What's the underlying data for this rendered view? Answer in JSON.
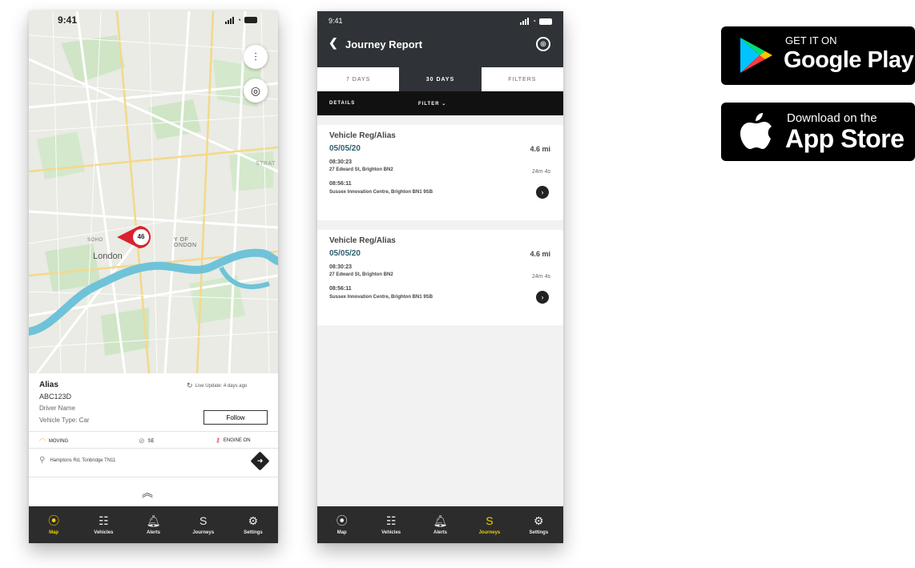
{
  "map_screen": {
    "status_time": "9:41",
    "map_labels": {
      "soho": "SOHO",
      "london": "London",
      "city": "Y OF\nONDON",
      "strat": "STRAT"
    },
    "marker_speed": "46",
    "vehicle": {
      "alias": "Alias",
      "reg": "ABC123D",
      "driver": "Driver Name",
      "vehicle_type": "Vehicle Type: Car",
      "live_update": "Live Update: 4 days ago",
      "follow_label": "Follow"
    },
    "stats": {
      "moving": "MOVING",
      "heading": "SE",
      "engine": "ENGINE ON"
    },
    "address": "Hamptons Rd, Tonbridge TN11",
    "tabs": [
      {
        "label": "Map",
        "icon": "map-pin-icon",
        "glyph": "⦿"
      },
      {
        "label": "Vehicles",
        "icon": "vehicles-icon",
        "glyph": "☷"
      },
      {
        "label": "Alerts",
        "icon": "bell-icon",
        "glyph": "🔔︎"
      },
      {
        "label": "Journeys",
        "icon": "journeys-icon",
        "glyph": "S"
      },
      {
        "label": "Settings",
        "icon": "gear-icon",
        "glyph": "⚙"
      }
    ]
  },
  "journey_screen": {
    "status_time": "9:41",
    "title": "Journey Report",
    "segments": [
      "7 DAYS",
      "30 DAYS",
      "FILTERS"
    ],
    "active_segment": "30 DAYS",
    "details_label": "DETAILS",
    "filter_label": "FILTER ⌄",
    "journeys": [
      {
        "vehicle": "Vehicle Reg/Alias",
        "date": "05/05/20",
        "distance": "4.6 mi",
        "start_time": "08:30:23",
        "start_address": "27 Edward St, Brighton BN2",
        "duration": "24m 4s",
        "end_time": "08:56:11",
        "end_address": "Sussex Innovation Centre, Brighton BN1 9SB"
      },
      {
        "vehicle": "Vehicle Reg/Alias",
        "date": "05/05/20",
        "distance": "4.6 mi",
        "start_time": "08:30:23",
        "start_address": "27 Edward St, Brighton BN2",
        "duration": "24m 4s",
        "end_time": "08:56:11",
        "end_address": "Sussex Innovation Centre, Brighton BN1 9SB"
      }
    ],
    "tabs": [
      {
        "label": "Map",
        "icon": "map-pin-icon",
        "glyph": "⦿"
      },
      {
        "label": "Vehicles",
        "icon": "vehicles-icon",
        "glyph": "☷"
      },
      {
        "label": "Alerts",
        "icon": "bell-icon",
        "glyph": "🔔︎"
      },
      {
        "label": "Journeys",
        "icon": "journeys-icon",
        "glyph": "S"
      },
      {
        "label": "Settings",
        "icon": "gear-icon",
        "glyph": "⚙"
      }
    ]
  },
  "store_badges": {
    "google_play": {
      "small": "GET IT ON",
      "big": "Google Play"
    },
    "app_store": {
      "small": "Download on the",
      "big": "App Store"
    }
  },
  "colors": {
    "accent_yellow": "#f0d000",
    "tabbar": "#2c2c2c",
    "header": "#2f3236",
    "marker_red": "#d9232e",
    "river": "#6fc3d8"
  }
}
